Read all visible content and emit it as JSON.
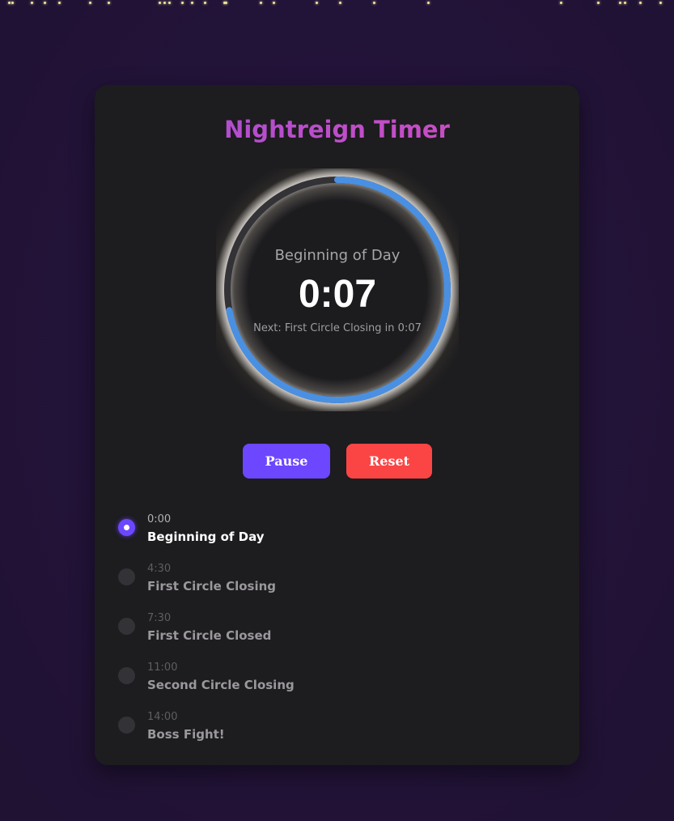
{
  "app": {
    "title": "Nightreign Timer"
  },
  "timer": {
    "current_phase": "Beginning of Day",
    "time_display": "0:07",
    "next_text": "Next: First Circle Closing in 0:07",
    "progress_fraction": 0.72
  },
  "controls": {
    "pause_label": "Pause",
    "reset_label": "Reset"
  },
  "phases": [
    {
      "time": "0:00",
      "name": "Beginning of Day",
      "active": true
    },
    {
      "time": "4:30",
      "name": "First Circle Closing",
      "active": false
    },
    {
      "time": "7:30",
      "name": "First Circle Closed",
      "active": false
    },
    {
      "time": "11:00",
      "name": "Second Circle Closing",
      "active": false
    },
    {
      "time": "14:00",
      "name": "Boss Fight!",
      "active": false
    }
  ],
  "colors": {
    "accent": "#6c47ff",
    "danger": "#fb4545",
    "ring_progress": "#4a90e2",
    "ring_track": "#333236",
    "card_bg": "#1d1c1f"
  }
}
